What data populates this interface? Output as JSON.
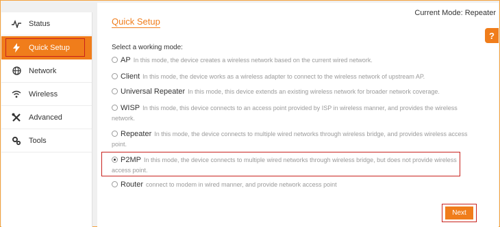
{
  "header": {
    "current_mode": "Current Mode: Repeater"
  },
  "sidebar": {
    "items": [
      {
        "label": "Status",
        "icon": "pulse-icon"
      },
      {
        "label": "Quick Setup",
        "icon": "lightning-icon",
        "active": true
      },
      {
        "label": "Network",
        "icon": "globe-icon"
      },
      {
        "label": "Wireless",
        "icon": "wifi-icon"
      },
      {
        "label": "Advanced",
        "icon": "tools-icon"
      },
      {
        "label": "Tools",
        "icon": "gears-icon"
      }
    ]
  },
  "main": {
    "title": "Quick Setup",
    "help": "?",
    "subhead": "Select a working mode:",
    "options": [
      {
        "name": "AP",
        "desc": "In this mode, the device creates a wireless network based on the current wired network.",
        "checked": false
      },
      {
        "name": "Client",
        "desc": "In this mode, the device works as a wireless adapter to connect to the wireless network of upstream AP.",
        "checked": false
      },
      {
        "name": "Universal Repeater",
        "desc": "In this mode, this device extends an existing wireless network for broader network coverage.",
        "checked": false
      },
      {
        "name": "WISP",
        "desc": "In this mode, this device connects to an access point provided by ISP in wireless manner, and provides the wireless network.",
        "checked": false
      },
      {
        "name": "Repeater",
        "desc": "In this mode, the device connects to multiple wired networks through wireless bridge, and provides wireless access point.",
        "checked": false
      },
      {
        "name": "P2MP",
        "desc": "In this mode, the device connects to multiple wired networks through wireless bridge, but does not provide wireless access point.",
        "checked": true
      },
      {
        "name": "Router",
        "desc": "connect to modem in wired manner, and provide network access point",
        "checked": false
      }
    ],
    "next_label": "Next"
  },
  "colors": {
    "accent": "#f07d1b",
    "highlight_border": "#c8201b"
  }
}
